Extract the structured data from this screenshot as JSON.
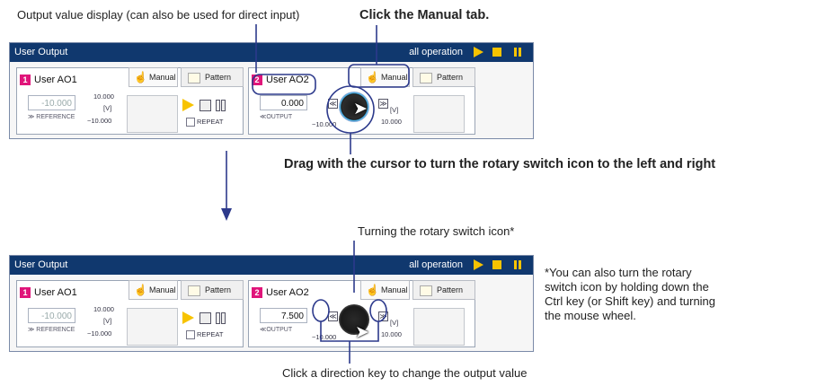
{
  "annotations": {
    "output_display": "Output value display (can also be used for direct input)",
    "click_manual": "Click the Manual tab.",
    "drag_rotary": "Drag with the cursor to turn the rotary switch icon to the left and right",
    "turning_rotary": "Turning the rotary switch icon*",
    "footnote": "*You can also turn the rotary switch icon by holding down the Ctrl key (or Shift key) and turning the mouse wheel.",
    "click_direction": "Click a direction key to change the output value"
  },
  "panels": [
    {
      "title": "User Output",
      "all_operation": "all operation",
      "ao1": {
        "num": "1",
        "name": "User AO1",
        "value": "-10.000",
        "ref": "≫ REFERENCE",
        "max": "10.000",
        "unit": "[V]",
        "min": "−10.000",
        "repeat": "REPEAT",
        "tab_manual": "Manual",
        "tab_pattern": "Pattern"
      },
      "ao2": {
        "num": "2",
        "name": "User AO2",
        "value": "0.000",
        "out": "≪OUTPUT",
        "max": "10.000",
        "unit": "[V]",
        "min": "−10.000",
        "tab_manual": "Manual",
        "tab_pattern": "Pattern",
        "dir_left": "≪",
        "dir_right": "≫"
      }
    },
    {
      "title": "User Output",
      "all_operation": "all operation",
      "ao1": {
        "num": "1",
        "name": "User AO1",
        "value": "-10.000",
        "ref": "≫ REFERENCE",
        "max": "10.000",
        "unit": "[V]",
        "min": "−10.000",
        "repeat": "REPEAT",
        "tab_manual": "Manual",
        "tab_pattern": "Pattern"
      },
      "ao2": {
        "num": "2",
        "name": "User AO2",
        "value": "7.500",
        "out": "≪OUTPUT",
        "max": "10.000",
        "unit": "[V]",
        "min": "−10.000",
        "tab_manual": "Manual",
        "tab_pattern": "Pattern",
        "dir_left": "≪",
        "dir_right": "≫"
      }
    }
  ],
  "colors": {
    "title_bar": "#10386e",
    "accent_yellow": "#f7c300",
    "badge_pink": "#e0157a",
    "callout_line": "#2d3a8c"
  }
}
